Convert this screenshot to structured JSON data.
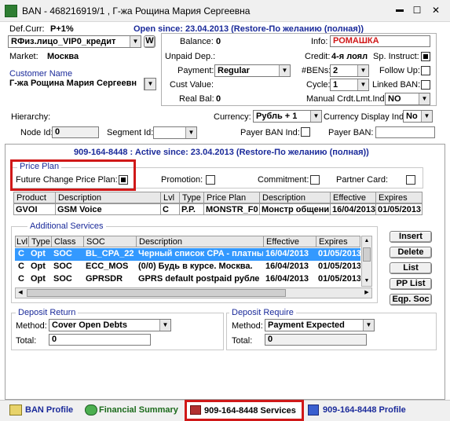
{
  "window": {
    "title": "BAN - 468216919/1 , Г-жа Рощина Мария Сергеевна",
    "controls": {
      "minimize": "▬",
      "maximize": "☐",
      "close": "✕"
    }
  },
  "top": {
    "def_curr_label": "Def.Curr:",
    "def_curr_value": "P+1%",
    "open_since": "Open since: 23.04.2013 (Restore-По желанию (полная))",
    "account_type": "RФиз.лицо_VIP0_кредит",
    "w_button": "W",
    "market_label": "Market:",
    "market_value": "Москва",
    "customer_name_label": "Customer Name",
    "customer_name_value": "Г-жа Рощина Мария Сергеевн"
  },
  "balance": {
    "balance_label": "Balance:",
    "balance_value": "0",
    "unpaid_label": "Unpaid Dep.:",
    "unpaid_value": "",
    "payment_label": "Payment:",
    "payment_value": "Regular",
    "cust_value_label": "Cust Value:",
    "cust_value_value": "",
    "real_bal_label": "Real Bal:",
    "real_bal_value": "0"
  },
  "info": {
    "info_label": "Info:",
    "info_value": "РОМАШКА",
    "credit_label": "Credit:",
    "credit_value": "4-я лоял",
    "sp_instruct_label": "Sp. Instruct:",
    "bens_label": "#BENs:",
    "bens_value": "2",
    "follow_up_label": "Follow Up:",
    "cycle_label": "Cycle:",
    "cycle_value": "1",
    "linked_ban_label": "Linked BAN:",
    "manual_crdt_label": "Manual Crdt.Lmt.Ind:",
    "manual_crdt_value": "NO"
  },
  "hierarchy": {
    "hierarchy_label": "Hierarchy:",
    "currency_label": "Currency:",
    "currency_value": "Рубль + 1",
    "currency_display_label": "Currency Display Ind:",
    "currency_display_value": "No",
    "node_id_label": "Node Id:",
    "node_id_value": "0",
    "segment_id_label": "Segment Id:",
    "segment_id_value": "",
    "payer_ban_ind_label": "Payer BAN Ind:",
    "payer_ban_label": "Payer BAN:",
    "payer_ban_value": ""
  },
  "subscriber": {
    "header": "909-164-8448 : Active since: 23.04.2013 (Restore-По желанию (полная))"
  },
  "price_plan": {
    "group_title": "Price Plan",
    "future_change_label": "Future Change Price Plan:",
    "promotion_label": "Promotion:",
    "commitment_label": "Commitment:",
    "partner_card_label": "Partner Card:",
    "columns": [
      "Product",
      "Description",
      "Lvl",
      "Type",
      "Price Plan",
      "Description",
      "Effective",
      "Expires"
    ],
    "row": [
      "GVOI",
      "GSM Voice",
      "C",
      "P.P.",
      "MONSTR_F0",
      "Монстр общени",
      "16/04/2013",
      "01/05/2013"
    ]
  },
  "additional_services": {
    "group_title": "Additional Services",
    "columns": [
      "Lvl",
      "Type",
      "Class",
      "SOC",
      "Description",
      "Effective",
      "Expires"
    ],
    "rows": [
      [
        "C",
        "Opt",
        "SOC",
        "BL_CPA_22",
        "Черный список CPA - платны",
        "16/04/2013",
        "01/05/2013"
      ],
      [
        "C",
        "Opt",
        "SOC",
        "ECC_MOS",
        "(0/0) Будь в курсе. Москва.",
        "16/04/2013",
        "01/05/2013"
      ],
      [
        "C",
        "Opt",
        "SOC",
        "GPRSDR",
        "GPRS default postpaid рубле",
        "16/04/2013",
        "01/05/2013"
      ]
    ],
    "buttons": [
      "Insert",
      "Delete",
      "List",
      "PP List",
      "Eqp. Soc"
    ]
  },
  "deposit_return": {
    "group_title": "Deposit Return",
    "method_label": "Method:",
    "method_value": "Cover Open Debts",
    "total_label": "Total:",
    "total_value": "0"
  },
  "deposit_require": {
    "group_title": "Deposit Require",
    "method_label": "Method:",
    "method_value": "Payment Expected",
    "total_label": "Total:",
    "total_value": "0"
  },
  "tabs": [
    {
      "label": "BAN Profile"
    },
    {
      "label": "Financial Summary"
    },
    {
      "label": "909-164-8448 Services"
    },
    {
      "label": "909-164-8448 Profile"
    }
  ],
  "colors": {
    "accent": "#1a2a9a",
    "highlight": "#d01818",
    "selection": "#3399ff"
  }
}
